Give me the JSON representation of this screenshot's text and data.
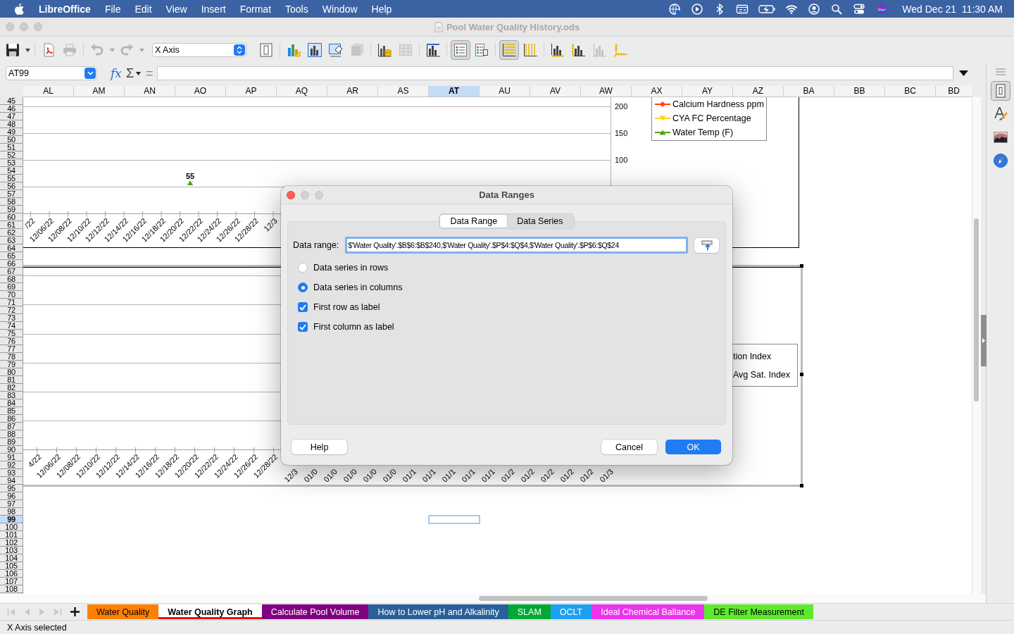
{
  "menubar": {
    "app": "LibreOffice",
    "menus": [
      "File",
      "Edit",
      "View",
      "Insert",
      "Format",
      "Tools",
      "Window",
      "Help"
    ],
    "clock": "Wed Dec 21  11:30 AM"
  },
  "window": {
    "title": "Pool Water Quality History.ods"
  },
  "toolbar": [
    {
      "kind": "save",
      "selected": false,
      "disabled": false
    },
    {
      "kind": "dropdown",
      "disabled": false
    },
    {
      "kind": "separator"
    },
    {
      "kind": "pdf",
      "selected": false,
      "disabled": false
    },
    {
      "kind": "print",
      "selected": false,
      "disabled": true
    },
    {
      "kind": "separator"
    },
    {
      "kind": "undo",
      "selected": false,
      "disabled": true
    },
    {
      "kind": "dropdown",
      "disabled": true
    },
    {
      "kind": "redo",
      "selected": false,
      "disabled": true
    },
    {
      "kind": "dropdown",
      "disabled": true
    },
    {
      "kind": "select",
      "value": "X Axis"
    },
    {
      "kind": "format-selection",
      "selected": false,
      "disabled": false
    },
    {
      "kind": "separator"
    },
    {
      "kind": "chart-type",
      "selected": false,
      "disabled": false
    },
    {
      "kind": "chart-area",
      "selected": false,
      "disabled": false
    },
    {
      "kind": "chart-wall",
      "selected": false,
      "disabled": false
    },
    {
      "kind": "perspective",
      "selected": false,
      "disabled": true
    },
    {
      "kind": "separator"
    },
    {
      "kind": "data-ranges",
      "selected": false,
      "disabled": false
    },
    {
      "kind": "data-table",
      "selected": false,
      "disabled": true
    },
    {
      "kind": "separator"
    },
    {
      "kind": "titles",
      "selected": false,
      "disabled": false
    },
    {
      "kind": "separator"
    },
    {
      "kind": "legend-toggle",
      "selected": true,
      "disabled": false
    },
    {
      "kind": "legend",
      "selected": false,
      "disabled": false
    },
    {
      "kind": "separator"
    },
    {
      "kind": "horizontal-grids",
      "selected": true,
      "disabled": false
    },
    {
      "kind": "vertical-grids",
      "selected": false,
      "disabled": false
    },
    {
      "kind": "separator"
    },
    {
      "kind": "x-axis",
      "selected": false,
      "disabled": false
    },
    {
      "kind": "y-axis",
      "selected": false,
      "disabled": false
    },
    {
      "kind": "z-axis",
      "selected": false,
      "disabled": true
    },
    {
      "kind": "all-axes",
      "selected": false,
      "disabled": false
    }
  ],
  "formula_bar": {
    "name_box": "AT99",
    "function_symbol": "fx",
    "sum_symbol": "Σ",
    "equals_symbol": "="
  },
  "sheet": {
    "columns": [
      {
        "label": "AL",
        "selected": false
      },
      {
        "label": "AM",
        "selected": false
      },
      {
        "label": "AN",
        "selected": false
      },
      {
        "label": "AO",
        "selected": false
      },
      {
        "label": "AP",
        "selected": false
      },
      {
        "label": "AQ",
        "selected": false
      },
      {
        "label": "AR",
        "selected": false
      },
      {
        "label": "AS",
        "selected": false
      },
      {
        "label": "AT",
        "selected": true
      },
      {
        "label": "AU",
        "selected": false
      },
      {
        "label": "AV",
        "selected": false
      },
      {
        "label": "AW",
        "selected": false
      },
      {
        "label": "AX",
        "selected": false
      },
      {
        "label": "AY",
        "selected": false
      },
      {
        "label": "AZ",
        "selected": false
      },
      {
        "label": "BA",
        "selected": false
      },
      {
        "label": "BB",
        "selected": false
      },
      {
        "label": "BC",
        "selected": false
      },
      {
        "label": "BD",
        "selected": false
      }
    ],
    "rows": [
      {
        "label": "45",
        "selected": false
      },
      {
        "label": "46",
        "selected": false
      },
      {
        "label": "47",
        "selected": false
      },
      {
        "label": "48",
        "selected": false
      },
      {
        "label": "49",
        "selected": false
      },
      {
        "label": "50",
        "selected": false
      },
      {
        "label": "51",
        "selected": false
      },
      {
        "label": "52",
        "selected": false
      },
      {
        "label": "53",
        "selected": false
      },
      {
        "label": "54",
        "selected": false
      },
      {
        "label": "55",
        "selected": false
      },
      {
        "label": "56",
        "selected": false
      },
      {
        "label": "57",
        "selected": false
      },
      {
        "label": "58",
        "selected": false
      },
      {
        "label": "59",
        "selected": false
      },
      {
        "label": "60",
        "selected": false
      },
      {
        "label": "61",
        "selected": false
      },
      {
        "label": "62",
        "selected": false
      },
      {
        "label": "63",
        "selected": false
      },
      {
        "label": "64",
        "selected": false
      },
      {
        "label": "65",
        "selected": false
      },
      {
        "label": "66",
        "selected": false
      },
      {
        "label": "67",
        "selected": false
      },
      {
        "label": "68",
        "selected": false
      },
      {
        "label": "69",
        "selected": false
      },
      {
        "label": "70",
        "selected": false
      },
      {
        "label": "71",
        "selected": false
      },
      {
        "label": "72",
        "selected": false
      },
      {
        "label": "73",
        "selected": false
      },
      {
        "label": "74",
        "selected": false
      },
      {
        "label": "75",
        "selected": false
      },
      {
        "label": "76",
        "selected": false
      },
      {
        "label": "77",
        "selected": false
      },
      {
        "label": "78",
        "selected": false
      },
      {
        "label": "79",
        "selected": false
      },
      {
        "label": "80",
        "selected": false
      },
      {
        "label": "81",
        "selected": false
      },
      {
        "label": "82",
        "selected": false
      },
      {
        "label": "83",
        "selected": false
      },
      {
        "label": "84",
        "selected": false
      },
      {
        "label": "85",
        "selected": false
      },
      {
        "label": "86",
        "selected": false
      },
      {
        "label": "87",
        "selected": false
      },
      {
        "label": "88",
        "selected": false
      },
      {
        "label": "89",
        "selected": false
      },
      {
        "label": "90",
        "selected": false
      },
      {
        "label": "91",
        "selected": false
      },
      {
        "label": "92",
        "selected": false
      },
      {
        "label": "93",
        "selected": false
      },
      {
        "label": "94",
        "selected": false
      },
      {
        "label": "95",
        "selected": false
      },
      {
        "label": "96",
        "selected": false
      },
      {
        "label": "97",
        "selected": false
      },
      {
        "label": "98",
        "selected": false
      },
      {
        "label": "99",
        "selected": true
      },
      {
        "label": "100",
        "selected": false
      },
      {
        "label": "101",
        "selected": false
      },
      {
        "label": "102",
        "selected": false
      },
      {
        "label": "103",
        "selected": false
      },
      {
        "label": "104",
        "selected": false
      },
      {
        "label": "105",
        "selected": false
      },
      {
        "label": "106",
        "selected": false
      },
      {
        "label": "107",
        "selected": false
      },
      {
        "label": "108",
        "selected": false
      }
    ],
    "charts": [
      {
        "selected": false,
        "y_ticks": [
          "200",
          "150",
          "100"
        ],
        "legend": [
          {
            "label": "Calcium Hardness ppm",
            "kind": "diamond",
            "color": "#ff420e"
          },
          {
            "label": "CYA FC Percentage",
            "kind": "triangledown",
            "color": "#ffd320"
          },
          {
            "label": "Water Temp (F)",
            "kind": "triangleup",
            "color": "#579d1c"
          }
        ],
        "point_label": "55",
        "x_labels": [
          "/22",
          "12/06/22",
          "12/08/22",
          "12/10/22",
          "12/12/22",
          "12/14/22",
          "12/16/22",
          "12/18/22",
          "12/20/22",
          "12/22/22",
          "12/24/22",
          "12/26/22",
          "12/28/22",
          "12/3"
        ]
      },
      {
        "selected": true,
        "legend": [
          {
            "label": "tion Index"
          },
          {
            "label": "Avg Sat. Index"
          }
        ],
        "x_labels": [
          "4/22",
          "12/06/22",
          "12/08/22",
          "12/10/22",
          "12/12/22",
          "12/14/22",
          "12/16/22",
          "12/18/22",
          "12/20/22",
          "12/22/22",
          "12/24/22",
          "12/26/22",
          "12/28/22",
          "12/3",
          "01/0",
          "01/0",
          "01/0",
          "01/0",
          "01/0",
          "01/1",
          "01/1",
          "01/1",
          "01/1",
          "01/1",
          "01/2",
          "01/2",
          "01/2",
          "01/2",
          "01/2",
          "01/3"
        ]
      }
    ]
  },
  "sidebar": [
    {
      "kind": "properties",
      "selected": true
    },
    {
      "kind": "styles",
      "selected": false
    },
    {
      "kind": "gallery",
      "selected": false
    },
    {
      "kind": "navigator",
      "selected": false
    }
  ],
  "dialog": {
    "title": "Data Ranges",
    "tabs": [
      {
        "label": "Data Range",
        "selected": true
      },
      {
        "label": "Data Series",
        "selected": false
      }
    ],
    "range_label": "Data range:",
    "range_value": "$'Water Quality'.$B$6:$B$240,$'Water Quality'.$P$4:$Q$4,$'Water Quality'.$P$6:$Q$24",
    "options": [
      {
        "kind": "radio",
        "label": "Data series in rows",
        "selected": false
      },
      {
        "kind": "radio",
        "label": "Data series in columns",
        "selected": true
      },
      {
        "kind": "checkbox",
        "label": "First row as label",
        "checked": true
      },
      {
        "kind": "checkbox",
        "label": "First column as label",
        "checked": true
      }
    ],
    "buttons": [
      {
        "label": "Help",
        "kind": "help"
      },
      {
        "label": "Cancel",
        "kind": "cancel"
      },
      {
        "label": "OK",
        "kind": "default"
      }
    ]
  },
  "sheet_tabs": [
    {
      "label": "Water Quality",
      "color": "#ff8000",
      "selected": false
    },
    {
      "label": "Water Quality Graph",
      "color": "#ff0000",
      "selected": true
    },
    {
      "label": "Calculate Pool Volume",
      "color": "#800080",
      "selected": false
    },
    {
      "label": "How to Lower pH and Alkalinity",
      "color": "#2a6099",
      "selected": false
    },
    {
      "label": "SLAM",
      "color": "#00a933",
      "selected": false
    },
    {
      "label": "OCLT",
      "color": "#1e9ff0",
      "selected": false
    },
    {
      "label": "Ideal Chemical Ballance",
      "color": "#ee33ee",
      "selected": false
    },
    {
      "label": "DE Filter Measurement",
      "color": "#5eea2c",
      "selected": false
    }
  ],
  "status_bar": "X Axis selected"
}
